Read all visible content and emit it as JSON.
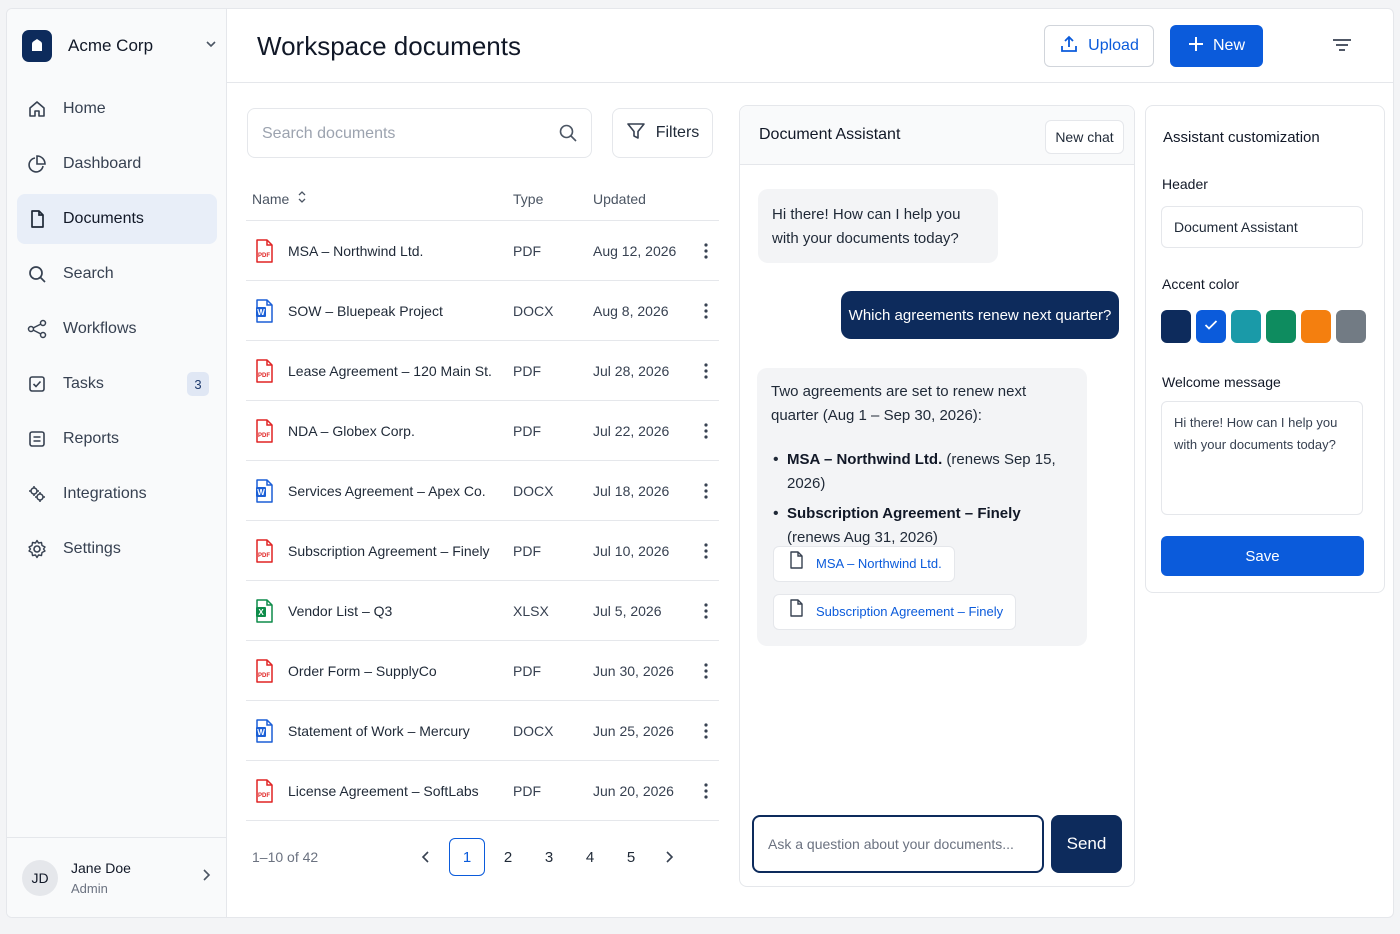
{
  "org": {
    "name": "Acme Corp"
  },
  "sidebar": {
    "items": [
      {
        "label": "Home",
        "icon": "home-icon"
      },
      {
        "label": "Dashboard",
        "icon": "dashboard-icon"
      },
      {
        "label": "Documents",
        "icon": "document-icon",
        "active": true
      },
      {
        "label": "Search",
        "icon": "search-icon"
      },
      {
        "label": "Workflows",
        "icon": "workflows-icon"
      },
      {
        "label": "Tasks",
        "icon": "tasks-icon",
        "badge": "3"
      },
      {
        "label": "Reports",
        "icon": "reports-icon"
      },
      {
        "label": "Integrations",
        "icon": "integrations-icon"
      },
      {
        "label": "Settings",
        "icon": "settings-icon"
      }
    ]
  },
  "user": {
    "initials": "JD",
    "name": "Jane Doe",
    "role": "Admin"
  },
  "header": {
    "title": "Workspace documents",
    "upload_label": "Upload",
    "new_label": "New"
  },
  "documents": {
    "search_placeholder": "Search documents",
    "filters_label": "Filters",
    "columns": {
      "name": "Name",
      "type": "Type",
      "updated": "Updated"
    },
    "rows": [
      {
        "name": "MSA – Northwind Ltd.",
        "type": "PDF",
        "updated": "Aug 12, 2026"
      },
      {
        "name": "SOW – Bluepeak Project",
        "type": "DOCX",
        "updated": "Aug 8, 2026"
      },
      {
        "name": "Lease Agreement – 120 Main St.",
        "type": "PDF",
        "updated": "Jul 28, 2026"
      },
      {
        "name": "NDA – Globex Corp.",
        "type": "PDF",
        "updated": "Jul 22, 2026"
      },
      {
        "name": "Services Agreement – Apex Co.",
        "type": "DOCX",
        "updated": "Jul 18, 2026"
      },
      {
        "name": "Subscription Agreement – Finely",
        "type": "PDF",
        "updated": "Jul 10, 2026"
      },
      {
        "name": "Vendor List – Q3",
        "type": "XLSX",
        "updated": "Jul 5, 2026"
      },
      {
        "name": "Order Form – SupplyCo",
        "type": "PDF",
        "updated": "Jun 30, 2026"
      },
      {
        "name": "Statement of Work – Mercury",
        "type": "DOCX",
        "updated": "Jun 25, 2026"
      },
      {
        "name": "License Agreement – SoftLabs",
        "type": "PDF",
        "updated": "Jun 20, 2026"
      }
    ],
    "pagination": {
      "summary": "1–10 of 42",
      "pages": [
        "1",
        "2",
        "3",
        "4",
        "5"
      ],
      "current": "1"
    }
  },
  "chat": {
    "title": "Document Assistant",
    "new_chat_label": "New chat",
    "greeting": "Hi there! How can I help you with your documents today?",
    "user_message": "Which agreements renew next quarter?",
    "answer": {
      "intro": "Two agreements are set to renew next quarter (Aug 1 – Sep 30, 2026):",
      "items": [
        {
          "name": "MSA – Northwind Ltd.",
          "detail": " (renews Sep 15, 2026)"
        },
        {
          "name": "Subscription Agreement – Finely",
          "detail": " (renews Aug 31, 2026)"
        }
      ],
      "sources": [
        "MSA – Northwind Ltd.",
        "Subscription Agreement – Finely"
      ]
    },
    "input_placeholder": "Ask a question about your documents...",
    "send_label": "Send"
  },
  "customization": {
    "title": "Assistant customization",
    "header_label": "Header",
    "header_value": "Document Assistant",
    "accent_label": "Accent color",
    "accent_colors": [
      "#0d2b5c",
      "#0b5bdb",
      "#1a9aa8",
      "#0e8c5f",
      "#f47f0f",
      "#727b84"
    ],
    "accent_selected": "#0b5bdb",
    "welcome_label": "Welcome message",
    "welcome_value": "Hi there! How can I help you with your documents today?",
    "save_label": "Save"
  },
  "colors": {
    "primary": "#0b5bdb",
    "navy": "#0d2b5c",
    "pdf": "#e02424",
    "docx": "#1b5fd6",
    "xlsx": "#0e8c4a"
  }
}
